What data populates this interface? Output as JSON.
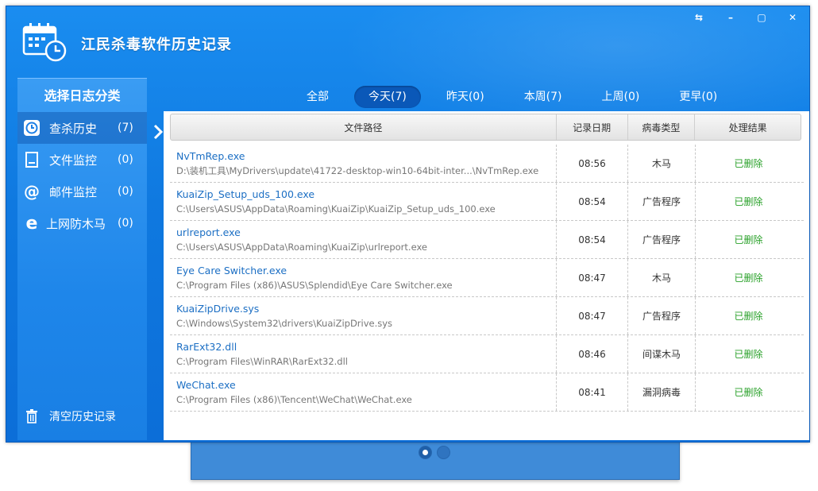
{
  "app": {
    "title": "江民杀毒软件历史记录"
  },
  "window_controls": {
    "restore": "⇆",
    "minimize": "–",
    "maximize": "▢",
    "close": "✕"
  },
  "sidebar": {
    "title": "选择日志分类",
    "items": [
      {
        "label": "查杀历史",
        "count": "(7)",
        "icon": "clock-icon"
      },
      {
        "label": "文件监控",
        "count": "(0)",
        "icon": "file-icon"
      },
      {
        "label": "邮件监控",
        "count": "(0)",
        "icon": "at-icon"
      },
      {
        "label": "上网防木马",
        "count": "(0)",
        "icon": "ie-icon"
      }
    ],
    "clear_label": "清空历史记录"
  },
  "tabs": [
    {
      "label": "全部"
    },
    {
      "label": "今天(7)"
    },
    {
      "label": "昨天(0)"
    },
    {
      "label": "本周(7)"
    },
    {
      "label": "上周(0)"
    },
    {
      "label": "更早(0)"
    }
  ],
  "table": {
    "headers": {
      "path": "文件路径",
      "time": "记录日期",
      "type": "病毒类型",
      "result": "处理结果"
    },
    "rows": [
      {
        "name": "NvTmRep.exe",
        "path": "D:\\装机工具\\MyDrivers\\update\\41722-desktop-win10-64bit-inter...\\NvTmRep.exe",
        "time": "08:56",
        "type": "木马",
        "result": "已删除"
      },
      {
        "name": "KuaiZip_Setup_uds_100.exe",
        "path": "C:\\Users\\ASUS\\AppData\\Roaming\\KuaiZip\\KuaiZip_Setup_uds_100.exe",
        "time": "08:54",
        "type": "广告程序",
        "result": "已删除"
      },
      {
        "name": "urlreport.exe",
        "path": "C:\\Users\\ASUS\\AppData\\Roaming\\KuaiZip\\urlreport.exe",
        "time": "08:54",
        "type": "广告程序",
        "result": "已删除"
      },
      {
        "name": "Eye Care Switcher.exe",
        "path": "C:\\Program Files (x86)\\ASUS\\Splendid\\Eye Care Switcher.exe",
        "time": "08:47",
        "type": "木马",
        "result": "已删除"
      },
      {
        "name": "KuaiZipDrive.sys",
        "path": "C:\\Windows\\System32\\drivers\\KuaiZipDrive.sys",
        "time": "08:47",
        "type": "广告程序",
        "result": "已删除"
      },
      {
        "name": "RarExt32.dll",
        "path": "C:\\Program Files\\WinRAR\\RarExt32.dll",
        "time": "08:46",
        "type": "间谍木马",
        "result": "已删除"
      },
      {
        "name": "WeChat.exe",
        "path": "C:\\Program Files (x86)\\Tencent\\WeChat\\WeChat.exe",
        "time": "08:41",
        "type": "漏洞病毒",
        "result": "已删除"
      }
    ]
  },
  "colors": {
    "accent": "#0f79e0",
    "link": "#1c6fc4",
    "success": "#2aa12a"
  }
}
